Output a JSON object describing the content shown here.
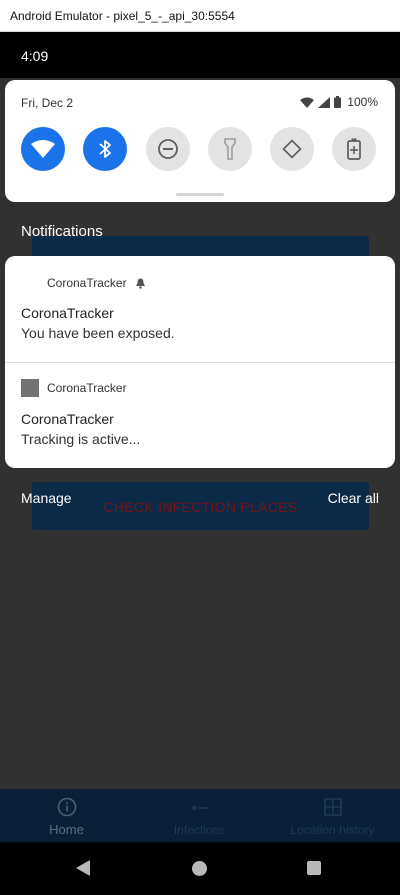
{
  "window": {
    "title": "Android Emulator - pixel_5_-_api_30:5554"
  },
  "statusbar": {
    "time": "4:09"
  },
  "quick_settings": {
    "date": "Fri, Dec 2",
    "battery_percent": "100%",
    "tiles": [
      {
        "name": "wifi-icon",
        "state": "on"
      },
      {
        "name": "bluetooth-icon",
        "state": "on"
      },
      {
        "name": "do-not-disturb-icon",
        "state": "off"
      },
      {
        "name": "flashlight-icon",
        "state": "off"
      },
      {
        "name": "auto-rotate-icon",
        "state": "off"
      },
      {
        "name": "battery-saver-icon",
        "state": "off"
      }
    ]
  },
  "notifications": {
    "header": "Notifications",
    "items": [
      {
        "app": "CoronaTracker",
        "title": "CoronaTracker",
        "body": "You have been exposed."
      },
      {
        "app": "CoronaTracker",
        "title": "CoronaTracker",
        "body": "Tracking is active..."
      }
    ],
    "manage_label": "Manage",
    "clear_all_label": "Clear all"
  },
  "background_app": {
    "button_label": "CHECK INFECTION PLACES",
    "nav": [
      {
        "label": "Home",
        "icon": "info-icon",
        "active": true
      },
      {
        "label": "Infections",
        "icon": "dots-icon",
        "active": false
      },
      {
        "label": "Location history",
        "icon": "map-icon",
        "active": false
      }
    ]
  },
  "colors": {
    "accent": "#1a73e8",
    "scrim": "#313131"
  }
}
